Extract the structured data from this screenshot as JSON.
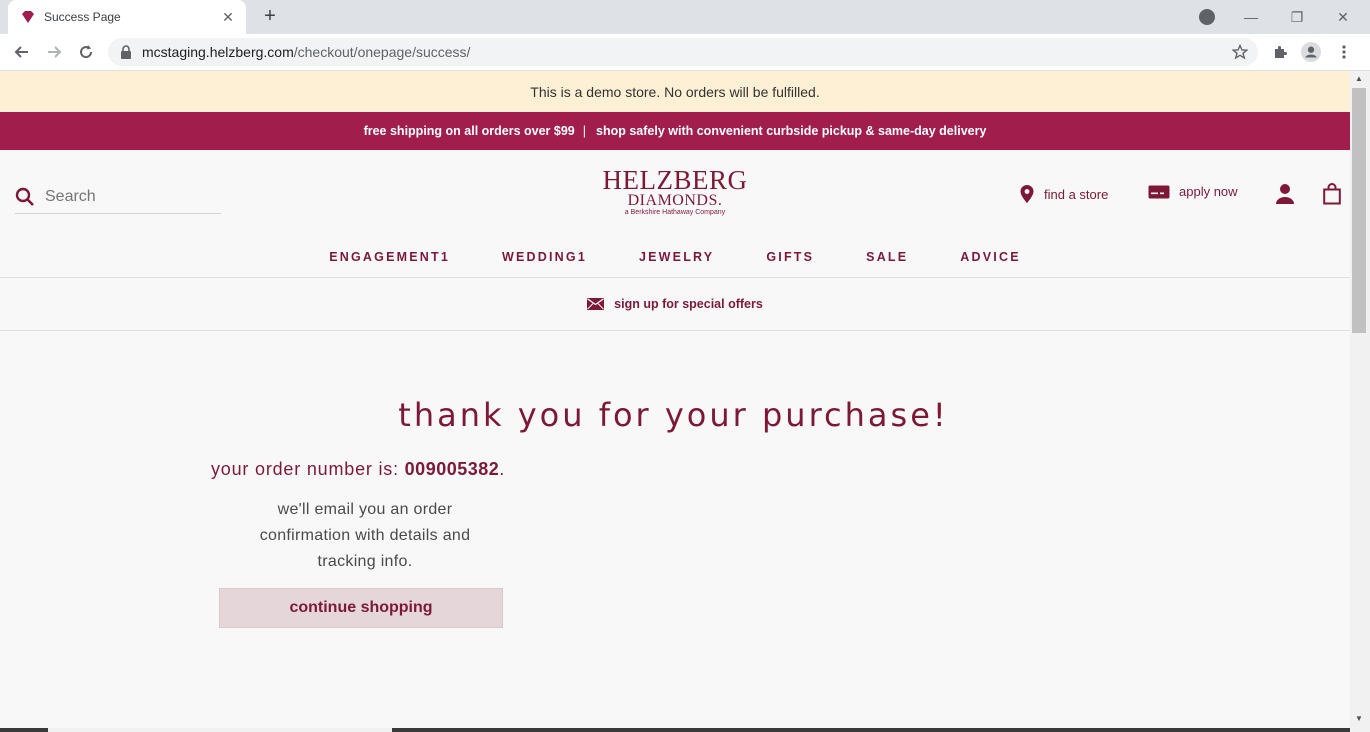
{
  "browser": {
    "tab_title": "Success Page",
    "tab_close": "✕",
    "new_tab": "+",
    "url_host": "mcstaging.helzberg.com",
    "url_path": "/checkout/onepage/success/",
    "window_controls": {
      "minimize": "—",
      "restore": "❐",
      "close": "✕"
    }
  },
  "demo_notice": "This is a demo store. No orders will be fulfilled.",
  "promo": {
    "left": "free shipping on all orders over $99",
    "separator": "|",
    "right": "shop safely with convenient curbside pickup & same-day delivery"
  },
  "header": {
    "search_placeholder": "Search",
    "logo": {
      "line1": "HELZBERG",
      "line2": "DIAMONDS.",
      "tagline": "a Berkshire Hathaway Company"
    },
    "find_store": "find a store",
    "apply_now": "apply now"
  },
  "nav": {
    "items": [
      {
        "label": "ENGAGEMENT1"
      },
      {
        "label": "WEDDING1"
      },
      {
        "label": "JEWELRY"
      },
      {
        "label": "GIFTS"
      },
      {
        "label": "SALE"
      },
      {
        "label": "ADVICE"
      }
    ]
  },
  "signup_text": "sign up for special offers",
  "success": {
    "heading": "thank you for your purchase!",
    "order_prefix": "your order number is: ",
    "order_number": "009005382",
    "order_suffix": ".",
    "email_note": "we'll email you an order confirmation with details and tracking info.",
    "continue_label": "continue shopping"
  },
  "colors": {
    "brand": "#7d1937",
    "promo_bg": "#a11d4c",
    "demo_bg": "#fdf0d5",
    "button_bg": "#e5d6d9"
  }
}
